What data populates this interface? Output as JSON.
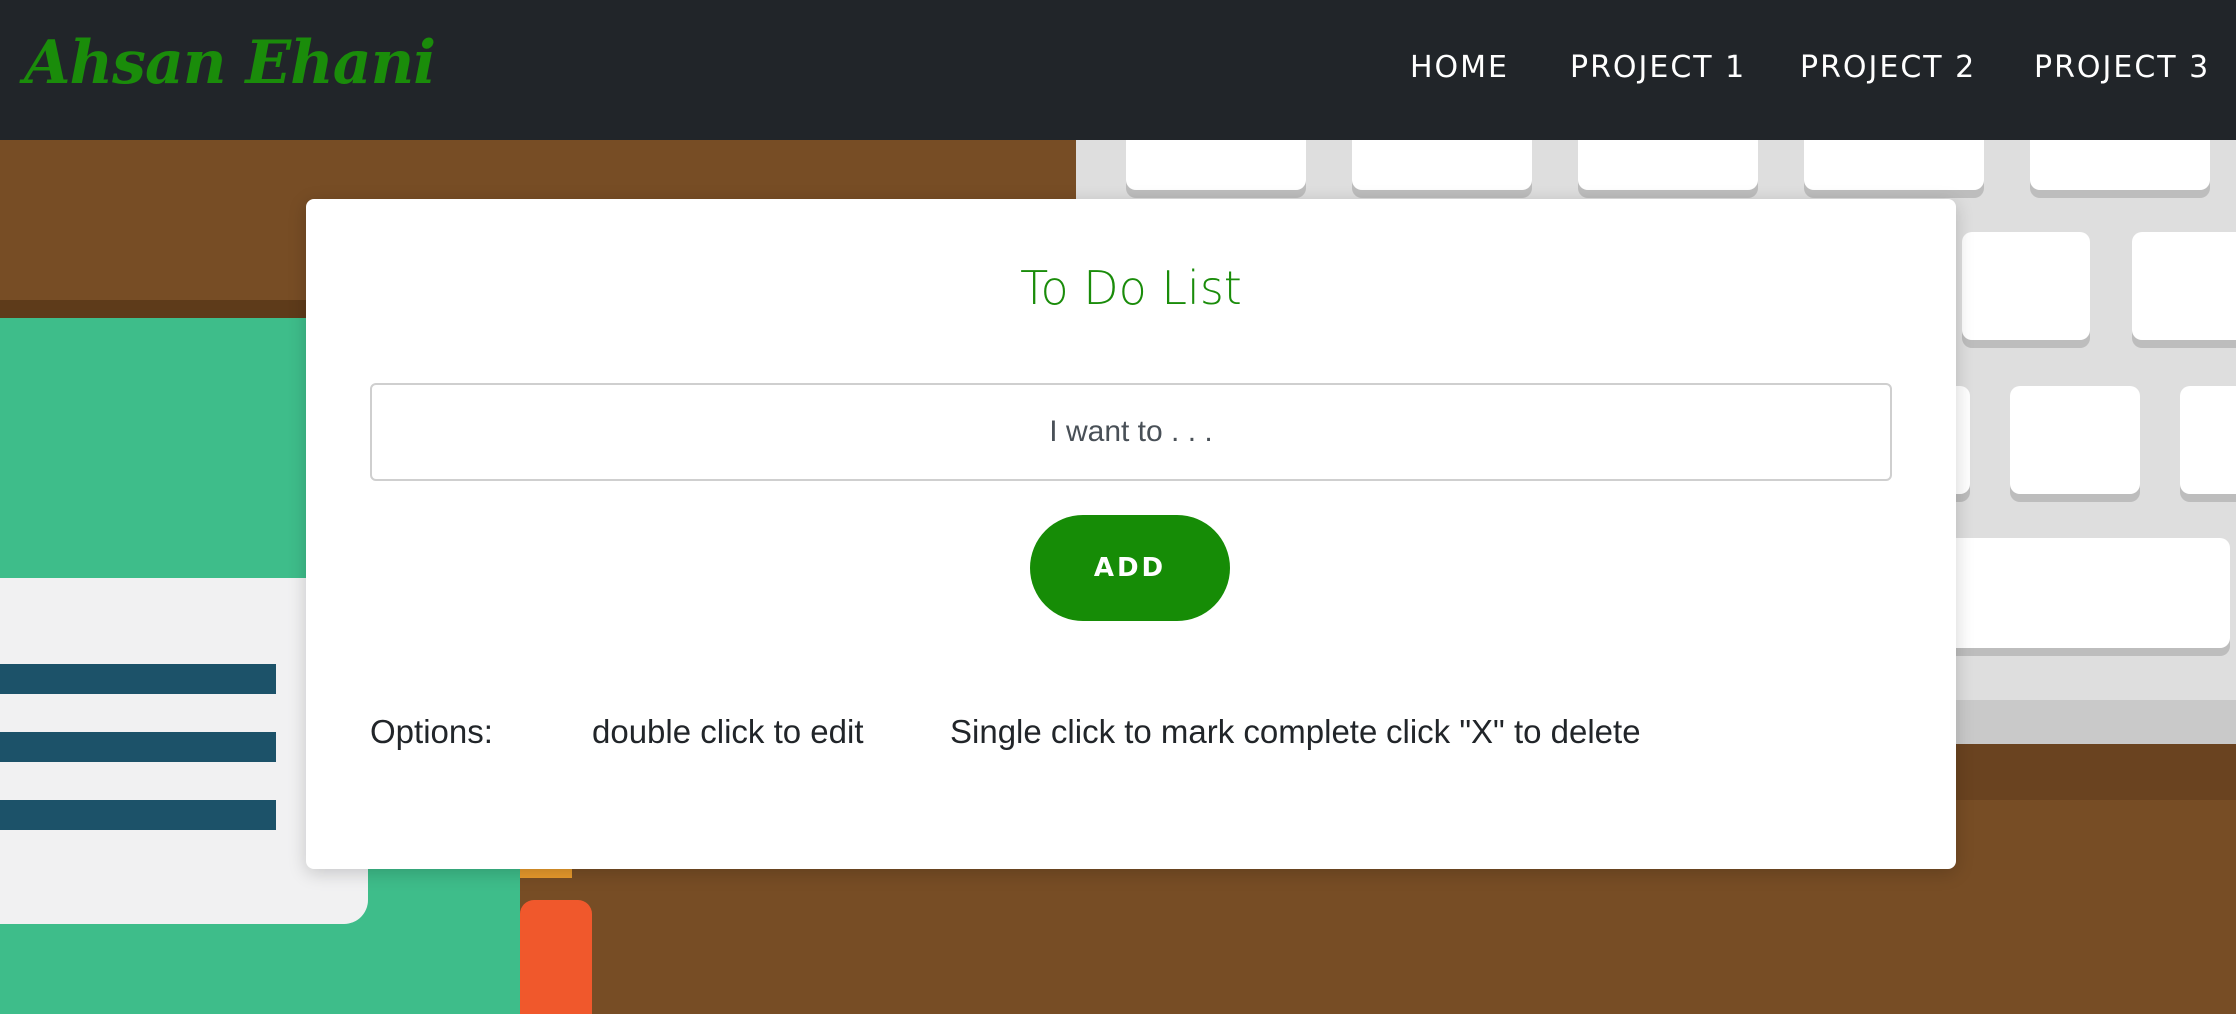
{
  "navbar": {
    "brand": "Ahsan Ehani",
    "links": [
      "HOME",
      "PROJECT 1",
      "PROJECT 2",
      "PROJECT 3"
    ]
  },
  "todo": {
    "title": "To Do List",
    "input_placeholder": "I want to . . .",
    "input_value": "",
    "add_label": "ADD",
    "options_label": "Options:",
    "options": [
      "double click to edit",
      "Single click to mark complete",
      "click \"X\" to delete"
    ]
  },
  "colors": {
    "navbar_bg": "#212529",
    "accent_green": "#168c06",
    "hero_brown": "#774d25"
  }
}
